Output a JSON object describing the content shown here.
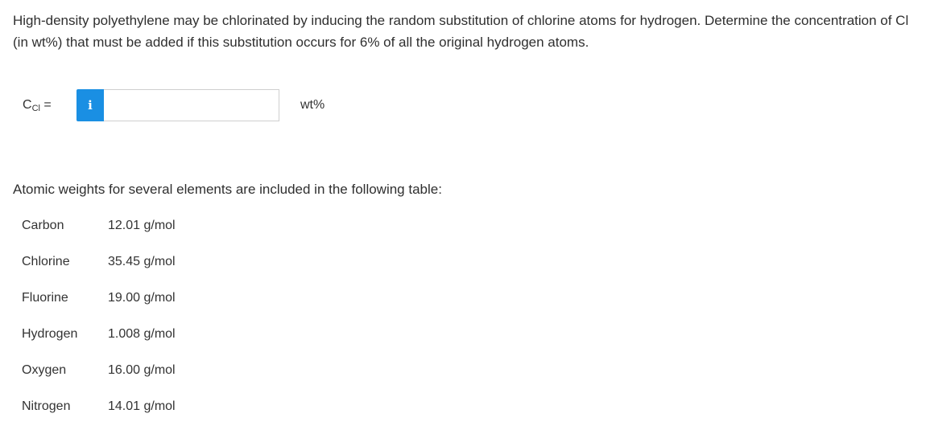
{
  "question": {
    "text": "High-density polyethylene may be chlorinated by inducing the random substitution of chlorine atoms for hydrogen. Determine the concentration of Cl (in wt%) that must be added if this substitution occurs for 6% of all the original hydrogen atoms."
  },
  "answer": {
    "var_main": "C",
    "var_sub": "Cl",
    "equals": "=",
    "info_icon": "i",
    "input_value": "",
    "unit": "wt%"
  },
  "table": {
    "intro": "Atomic weights for several elements are included in the following table:",
    "rows": [
      {
        "element": "Carbon",
        "weight": "12.01 g/mol"
      },
      {
        "element": "Chlorine",
        "weight": "35.45 g/mol"
      },
      {
        "element": "Fluorine",
        "weight": "19.00 g/mol"
      },
      {
        "element": "Hydrogen",
        "weight": "1.008 g/mol"
      },
      {
        "element": "Oxygen",
        "weight": "16.00 g/mol"
      },
      {
        "element": "Nitrogen",
        "weight": "14.01 g/mol"
      }
    ]
  },
  "colors": {
    "info_button": "#1a8fe3",
    "text": "#333333"
  }
}
